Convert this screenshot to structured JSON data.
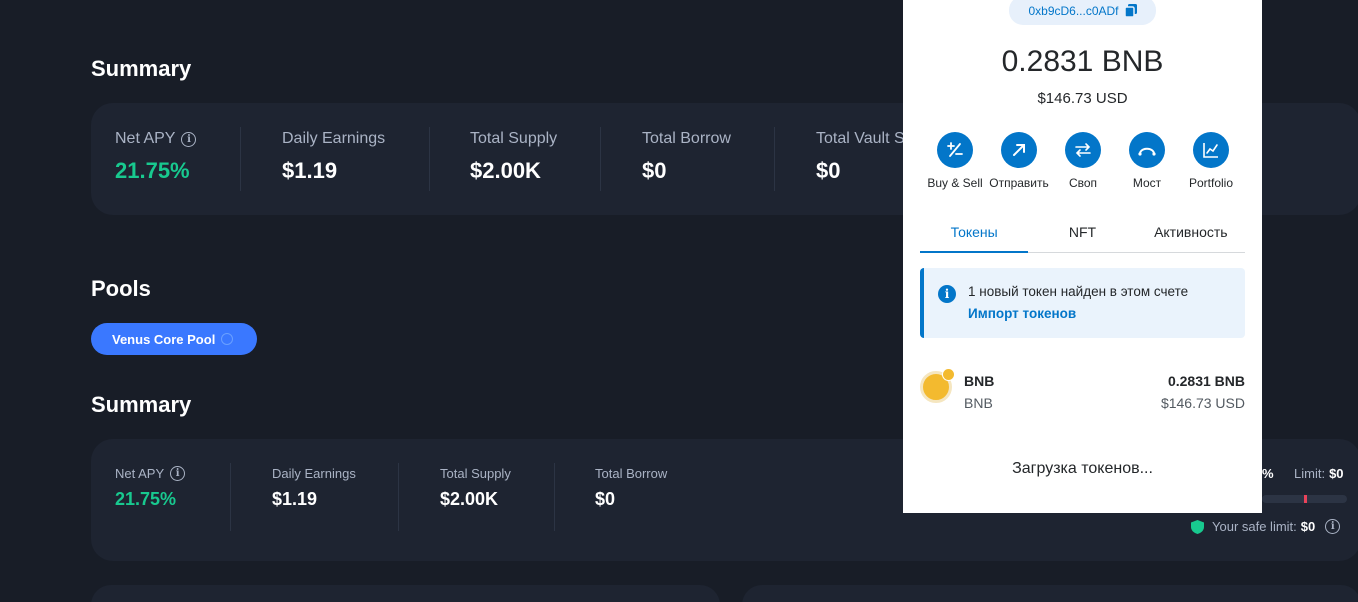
{
  "summary_top": {
    "title": "Summary",
    "stats": [
      {
        "label": "Net APY",
        "value": "21.75%"
      },
      {
        "label": "Daily Earnings",
        "value": "$1.19"
      },
      {
        "label": "Total Supply",
        "value": "$2.00K"
      },
      {
        "label": "Total Borrow",
        "value": "$0"
      },
      {
        "label": "Total Vault S",
        "value": "$0"
      }
    ]
  },
  "pools": {
    "title": "Pools",
    "selected_pool": "Venus Core Pool"
  },
  "summary_pool": {
    "title": "Summary",
    "stats": [
      {
        "label": "Net APY",
        "value": "21.75%"
      },
      {
        "label": "Daily Earnings",
        "value": "$1.19"
      },
      {
        "label": "Total Supply",
        "value": "$2.00K"
      },
      {
        "label": "Total Borrow",
        "value": "$0"
      }
    ],
    "partial_percent": "%",
    "limit_label": "Limit:",
    "limit_value": "$0",
    "safe_limit_label": "Your safe limit:",
    "safe_limit_value": "$0"
  },
  "wallet": {
    "address": "0xb9cD6...c0ADf",
    "balance": "0.2831 BNB",
    "fiat": "$146.73 USD",
    "actions": [
      {
        "label": "Buy & Sell",
        "icon": "plus-minus-icon"
      },
      {
        "label": "Отправить",
        "icon": "arrow-up-right-icon"
      },
      {
        "label": "Своп",
        "icon": "swap-arrows-icon"
      },
      {
        "label": "Мост",
        "icon": "bridge-icon"
      },
      {
        "label": "Portfolio",
        "icon": "chart-line-icon"
      }
    ],
    "tabs": [
      "Токены",
      "NFT",
      "Активность"
    ],
    "active_tab": "Токены",
    "notice_text": "1 новый токен найден в этом счете",
    "notice_link": "Импорт токенов",
    "token": {
      "name": "BNB",
      "symbol": "BNB",
      "amount": "0.2831 BNB",
      "fiat": "$146.73 USD"
    },
    "loading_text": "Загрузка токенов..."
  },
  "colors": {
    "background": "#181d27",
    "card": "#1e2431",
    "accent_green": "#18c98f",
    "pool_button": "#3a78ff",
    "wallet_blue": "#0376c9"
  }
}
